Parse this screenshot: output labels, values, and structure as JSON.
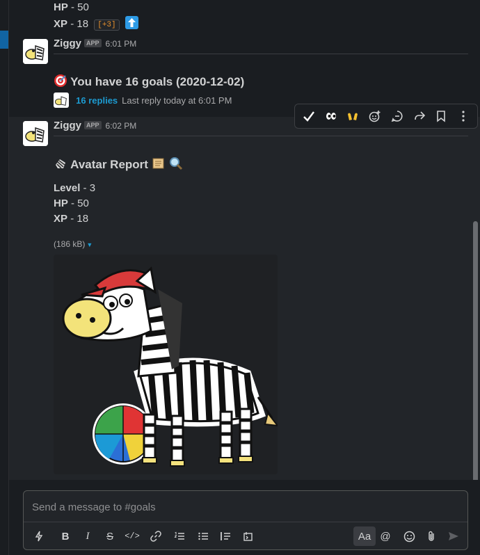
{
  "previous_stats": {
    "hp_label": "HP",
    "hp_value": "- 50",
    "xp_label": "XP",
    "xp_value": "- 18",
    "xp_delta": "[+3]"
  },
  "messages": [
    {
      "sender": "Ziggy",
      "badge": "APP",
      "time": "6:01 PM",
      "text": "You have 16 goals (2020-12-02)",
      "replies": "16 replies",
      "last_reply": "Last reply today at 6:01 PM"
    },
    {
      "sender": "Ziggy",
      "badge": "APP",
      "time": "6:02 PM",
      "title": "Avatar Report",
      "level_label": "Level",
      "level_value": "- 3",
      "hp_label": "HP",
      "hp_value": "- 50",
      "xp_label": "XP",
      "xp_value": "- 18",
      "file_size": "(186 kB)"
    }
  ],
  "composer": {
    "placeholder": "Send a message to #goals",
    "format_toggle": "Aa"
  },
  "icons": {
    "toolbar": [
      "checkmark-icon",
      "eyes-icon",
      "raised-hands-icon",
      "add-reaction-icon",
      "reply-thread-icon",
      "share-icon",
      "bookmark-icon",
      "more-actions-icon"
    ],
    "composer": [
      "shortcuts-icon",
      "bold-icon",
      "italic-icon",
      "strikethrough-icon",
      "code-icon",
      "link-icon",
      "ordered-list-icon",
      "bulleted-list-icon",
      "blockquote-icon",
      "code-block-icon",
      "format-toggle",
      "mention-icon",
      "emoji-icon",
      "attach-icon",
      "send-icon"
    ]
  },
  "colors": {
    "link": "#1d9bd1",
    "background": "#1a1d21",
    "accent_up": "#2e9be6"
  }
}
